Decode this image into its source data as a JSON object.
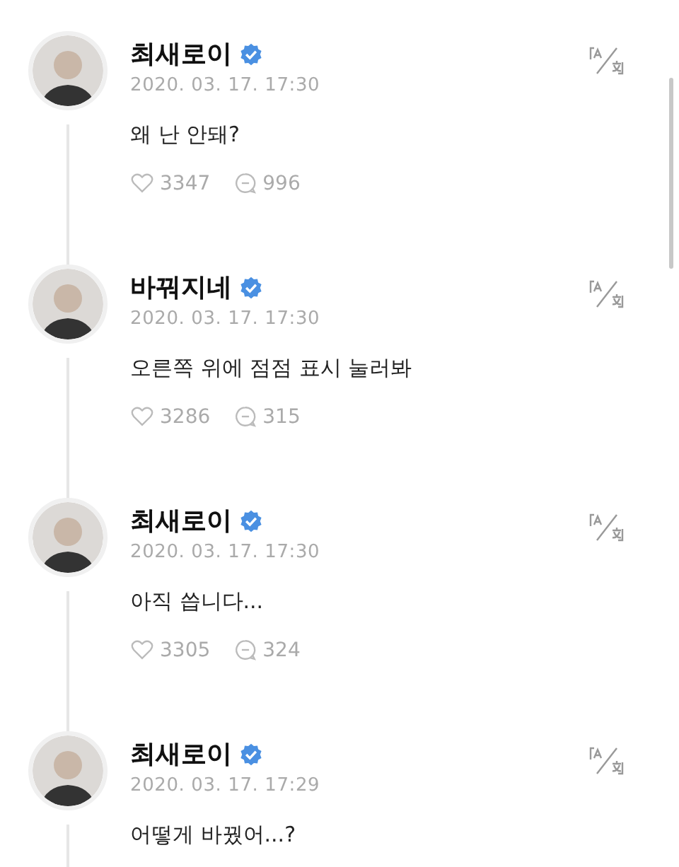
{
  "posts": [
    {
      "author": "최새로이",
      "verified": true,
      "time": "2020. 03. 17. 17:30",
      "text": "왜 난 안돼?",
      "likes": "3347",
      "comments": "996"
    },
    {
      "author": "바꿔지네",
      "verified": true,
      "time": "2020. 03. 17. 17:30",
      "text": "오른쪽 위에 점점 표시 눌러봐",
      "likes": "3286",
      "comments": "315"
    },
    {
      "author": "최새로이",
      "verified": true,
      "time": "2020. 03. 17. 17:30",
      "text": "아직 씁니다...",
      "likes": "3305",
      "comments": "324"
    },
    {
      "author": "최새로이",
      "verified": true,
      "time": "2020. 03. 17. 17:29",
      "text": "어떻게 바꿨어...?"
    }
  ]
}
